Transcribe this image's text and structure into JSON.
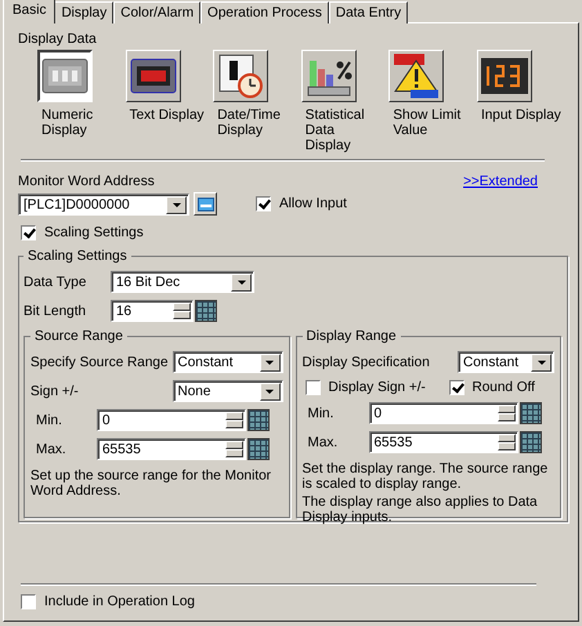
{
  "tabs": [
    {
      "label": "Basic",
      "selected": true
    },
    {
      "label": "Display",
      "selected": false
    },
    {
      "label": "Color/Alarm",
      "selected": false
    },
    {
      "label": "Operation Process",
      "selected": false
    },
    {
      "label": "Data Entry",
      "selected": false
    }
  ],
  "display_data": {
    "label": "Display Data",
    "types": [
      {
        "label": "Numeric Display",
        "kind": "numeric",
        "selected": true
      },
      {
        "label": "Text Display",
        "kind": "text",
        "selected": false
      },
      {
        "label": "Date/Time Display",
        "kind": "datetime",
        "selected": false
      },
      {
        "label": "Statistical Data Display",
        "kind": "statistical",
        "selected": false
      },
      {
        "label": "Show Limit Value",
        "kind": "limit",
        "selected": false
      },
      {
        "label": "Input Display",
        "kind": "input",
        "selected": false
      }
    ]
  },
  "monitor": {
    "label": "Monitor Word Address",
    "link": ">>Extended",
    "address": "[PLC1]D0000000",
    "allow_input": {
      "label": "Allow Input",
      "checked": true
    }
  },
  "scaling_checkbox": {
    "label": "Scaling Settings",
    "checked": true
  },
  "scaling_group": {
    "title": "Scaling Settings",
    "data_type": {
      "label": "Data Type",
      "value": "16 Bit Dec"
    },
    "bit_length": {
      "label": "Bit Length",
      "value": "16"
    }
  },
  "source_range": {
    "title": "Source Range",
    "specify": {
      "label": "Specify Source Range",
      "value": "Constant"
    },
    "sign": {
      "label": "Sign +/-",
      "value": "None"
    },
    "min": {
      "label": "Min.",
      "value": "0"
    },
    "max": {
      "label": "Max.",
      "value": "65535"
    },
    "notes": [
      "Set up the source range for the Monitor Word Address."
    ]
  },
  "display_range": {
    "title": "Display Range",
    "specify": {
      "label": "Display Specification",
      "value": "Constant"
    },
    "display_sign": {
      "label": "Display Sign +/-",
      "checked": false
    },
    "round_off": {
      "label": "Round Off",
      "checked": true
    },
    "min": {
      "label": "Min.",
      "value": "0"
    },
    "max": {
      "label": "Max.",
      "value": "65535"
    },
    "notes": [
      "Set the display range.  The source range is scaled to display range.",
      "The display range also applies to Data Display inputs."
    ]
  },
  "operation_log": {
    "label": "Include in Operation Log",
    "checked": false
  }
}
